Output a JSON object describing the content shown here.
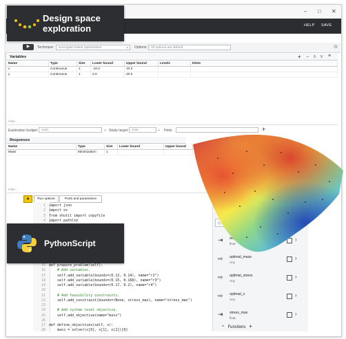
{
  "window": {
    "minimize": "–",
    "maximize": "□",
    "close": "✕"
  },
  "menubar": {
    "help": "HELP",
    "save": "SAVE"
  },
  "toolbar": {
    "technique_label": "Technique:",
    "technique_value": "Surrogate based optimization",
    "options_label": "Options:",
    "options_value": "All options are default"
  },
  "variables": {
    "title": "Variables",
    "headers": [
      "Name",
      "Type",
      "Size",
      "Lower bound",
      "Upper bound",
      "Levels",
      "Hints"
    ],
    "rows": [
      [
        "x",
        "Continuous",
        "1",
        "-10.0",
        "10.0",
        "",
        ""
      ],
      [
        "y",
        "Continuous",
        "1",
        "0.0",
        "20.0",
        "",
        ""
      ]
    ],
    "filter": "Filter..."
  },
  "budget": {
    "budget_label": "Exploration budget:",
    "budget_value": "Auto",
    "study_label": "Study target:",
    "study_value": "Auto",
    "hints_label": "Hints:"
  },
  "responses": {
    "title": "Responses",
    "headers": [
      "Name",
      "Type",
      "Size",
      "Lower bound",
      "Upper bound"
    ],
    "rows": [
      [
        "Mass",
        "Minimization",
        "1",
        "",
        ""
      ]
    ],
    "filter": "Filter..."
  },
  "bottom_tabs": {
    "run_options": "Run options",
    "ports": "Ports and parameters"
  },
  "code_lines": [
    {
      "n": "1",
      "t": "import json"
    },
    {
      "n": "2",
      "t": "import os"
    },
    {
      "n": "3",
      "t": "from shutil import copyfile"
    },
    {
      "n": "4",
      "t": "import pathlib"
    },
    {
      "n": "",
      "t": ""
    },
    {
      "n": "",
      "t": "                   (stress_max)\")"
    },
    {
      "n": "",
      "t": ""
    },
    {
      "n": "",
      "t": "                  rained):"
    },
    {
      "n": "",
      "t": ""
    },
    {
      "n": "",
      "t": ""
    },
    {
      "n": "",
      "t": ""
    },
    {
      "n": "",
      "t": ""
    },
    {
      "n": "15",
      "t": "def prepare_problem(self):"
    },
    {
      "n": "16",
      "t": "    # Add variables."
    },
    {
      "n": "17",
      "t": "    self.add_variable(bounds=(0.12, 0.14), name=\"r2\")"
    },
    {
      "n": "18",
      "t": "    self.add_variable(bounds=(0.15, 0.168), name=\"r3\")"
    },
    {
      "n": "19",
      "t": "    self.add_variable(bounds=(0.17, 0.2), name=\"r4\")"
    },
    {
      "n": "20",
      "t": ""
    },
    {
      "n": "21",
      "t": "    # Add feasibility constraints."
    },
    {
      "n": "22",
      "t": "    self.add_constraint(bounds=(None, stress_max), name=\"stress_max\")"
    },
    {
      "n": "23",
      "t": ""
    },
    {
      "n": "24",
      "t": "    # Add system level objective."
    },
    {
      "n": "25",
      "t": "    self.add_objective(name=\"mass\")"
    },
    {
      "n": "26",
      "t": ""
    },
    {
      "n": "27",
      "t": "def define_objectives(self, x):"
    },
    {
      "n": "28",
      "t": "    mass = solver(x[0], x[1], x[2])[0]"
    },
    {
      "n": "29",
      "t": "    self.iter_num += 1"
    }
  ],
  "right_panel": {
    "search_placeholder": "Q...",
    "items": [
      {
        "name": "max_iter",
        "type": "float"
      },
      {
        "name": "optimal_mass",
        "type": "Any"
      },
      {
        "name": "optimal_stress",
        "type": "Any"
      },
      {
        "name": "optimal_x",
        "type": "Any"
      },
      {
        "name": "stress_max",
        "type": "float"
      }
    ],
    "functions": "Functions",
    "plus": "+",
    "chevron": "^"
  },
  "badges": {
    "design": "Design space exploration",
    "python": "PythonScript"
  },
  "colors": {
    "badge_bg": "#2d2e31",
    "menubar_bg": "#2b2d30",
    "accent_yellow": "#f2c200",
    "python_blue": "#3f7cc0",
    "python_yellow": "#f7cf3c"
  }
}
